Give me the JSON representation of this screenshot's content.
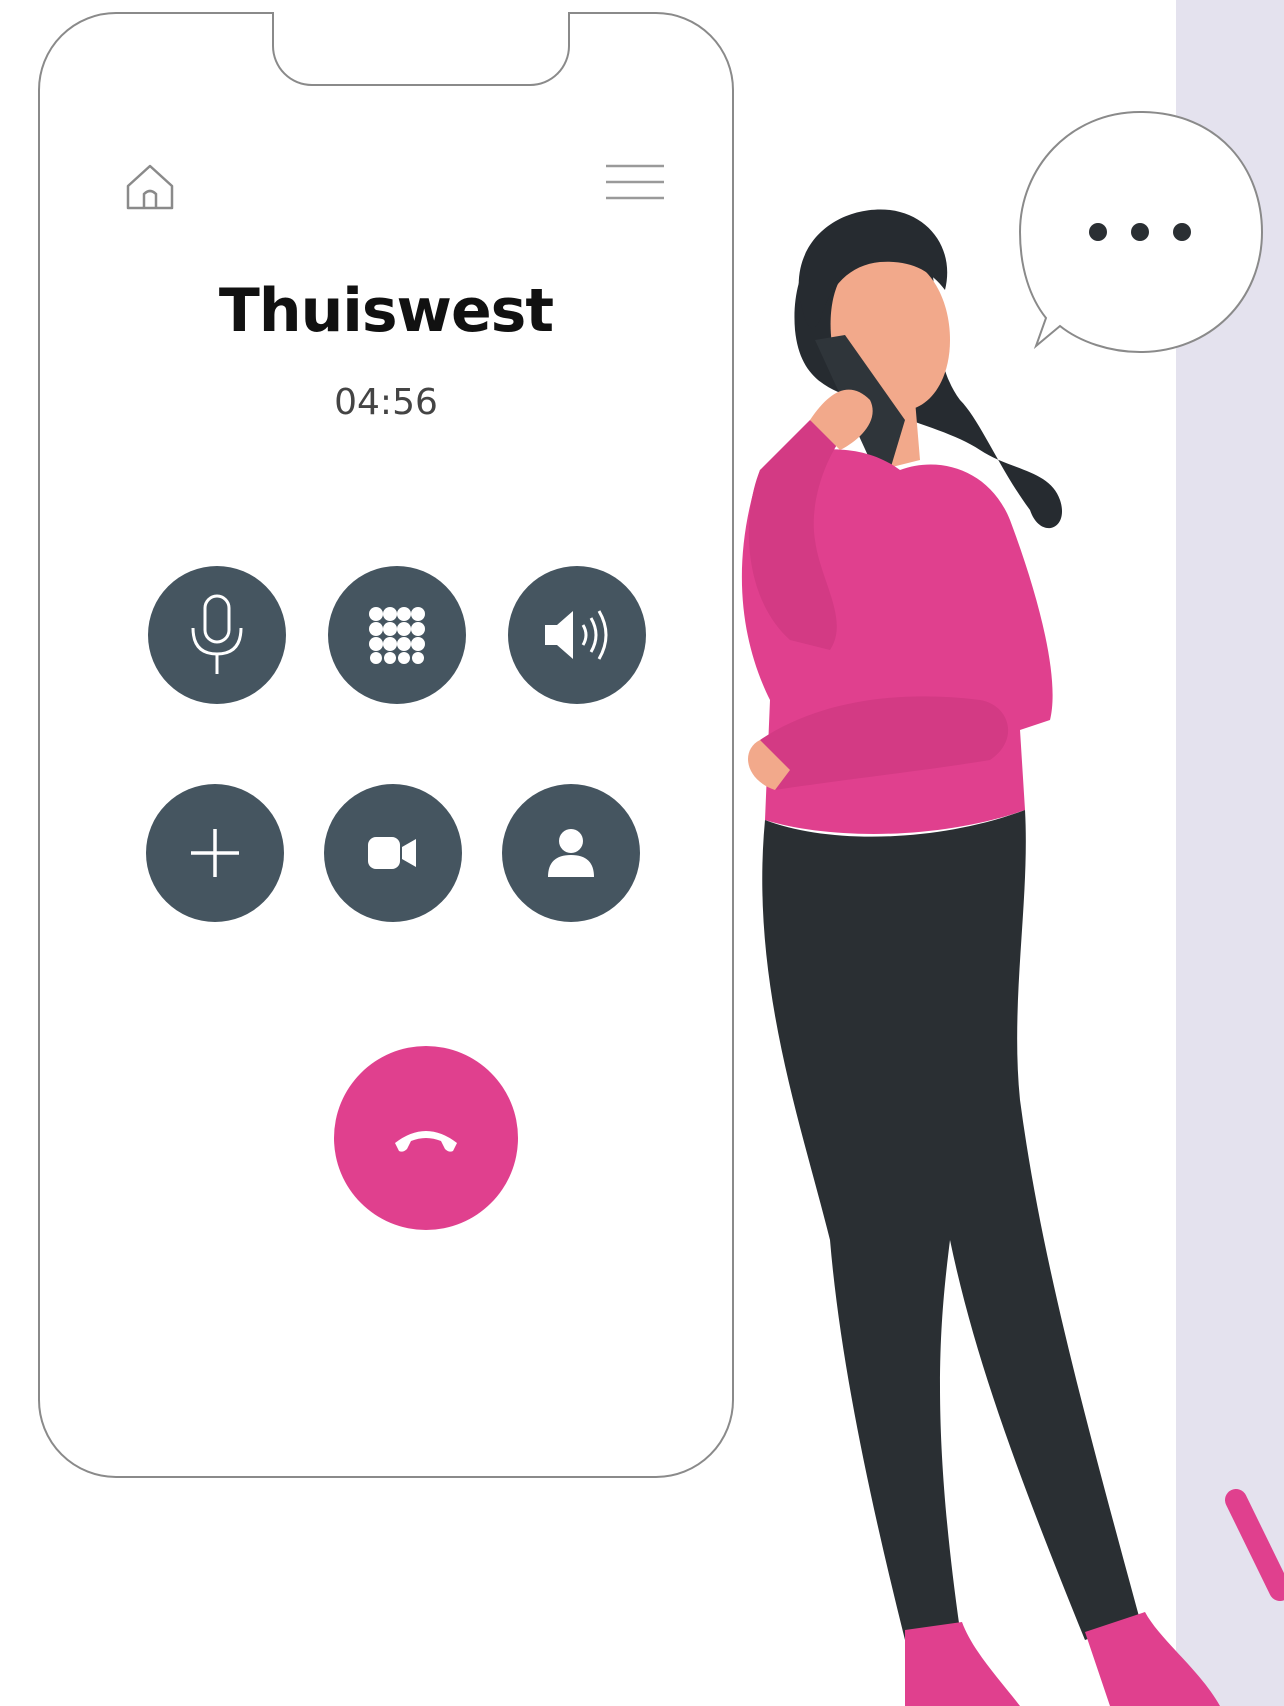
{
  "call": {
    "contact_name": "Thuiswest",
    "duration": "04:56"
  },
  "controls": {
    "row1": [
      "microphone-icon",
      "keypad-icon",
      "speaker-icon"
    ],
    "row2": [
      "add-call-icon",
      "video-camera-icon",
      "contact-icon"
    ],
    "end_call": "phone-hangup-icon"
  },
  "nav": {
    "left": "home-icon",
    "right": "hamburger-menu-icon"
  },
  "colors": {
    "control_bg": "#455560",
    "end_call_bg": "#e0408e",
    "accent_pink": "#e0408e",
    "side_panel": "#e4e2ee",
    "pants": "#2a2f33"
  }
}
